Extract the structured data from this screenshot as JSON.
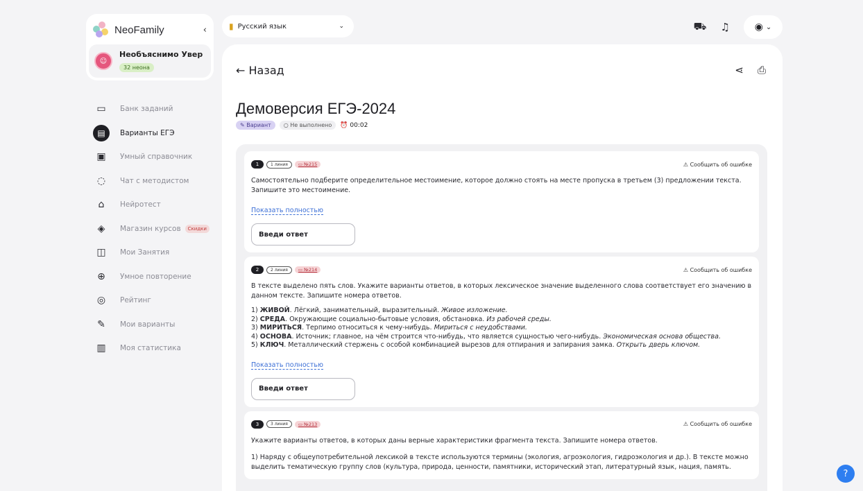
{
  "brand": {
    "name": "NeoFamily",
    "collapse_icon": "chevron-left-icon"
  },
  "user": {
    "name": "Необъяснимо Уверенн…",
    "neon": "32 неона"
  },
  "nav": {
    "items": [
      {
        "label": "Банк заданий",
        "icon": "archive-icon"
      },
      {
        "label": "Варианты ЕГЭ",
        "icon": "document-icon"
      },
      {
        "label": "Умный справочник",
        "icon": "book-icon"
      },
      {
        "label": "Чат с методистом",
        "icon": "chat-icon"
      },
      {
        "label": "Нейротест",
        "icon": "robot-icon"
      },
      {
        "label": "Магазин курсов",
        "icon": "graduation-cap-icon",
        "badge": "Скидки"
      },
      {
        "label": "Мои Занятия",
        "icon": "open-book-icon"
      },
      {
        "label": "Умное повторение",
        "icon": "brain-icon"
      },
      {
        "label": "Рейтинг",
        "icon": "target-icon"
      },
      {
        "label": "Мои варианты",
        "icon": "pencil-icon"
      },
      {
        "label": "Моя статистика",
        "icon": "bar-chart-icon"
      }
    ]
  },
  "subject": {
    "label": "Русский язык"
  },
  "main": {
    "back_label": "Назад",
    "title": "Демоверсия ЕГЭ-2024",
    "variant_tag": "Вариант",
    "status": "Не выполнено",
    "timer": "00:02"
  },
  "tasks": [
    {
      "num": "1",
      "line": "1 линия",
      "bank": "№215",
      "report": "Сообщить об ошибке",
      "text": "Самостоятельно подберите определительное местоимение, которое должно стоять на месте пропуска в третьем (3) предложении текста. Запишите это местоимение.",
      "show_full": "Показать полностью",
      "answer_placeholder": "Введи ответ"
    },
    {
      "num": "2",
      "line": "2 линия",
      "bank": "№214",
      "report": "Сообщить об ошибке",
      "text": "В тексте выделено пять слов. Укажите варианты ответов, в которых лексическое значение выделенного слова соответствует его значению в данном тексте. Запишите номера ответов.",
      "items": [
        {
          "n": "1) ",
          "word": "ЖИВОЙ",
          "desc": ". Лёгкий, занимательный, выразительный. ",
          "ex": "Живое изложение."
        },
        {
          "n": "2) ",
          "word": "СРЕДА",
          "desc": ". Окружающие социально-бытовые условия, обстановка. ",
          "ex": "Из рабочей среды."
        },
        {
          "n": "3) ",
          "word": "МИРИТЬСЯ",
          "desc": ". Терпимо относиться к чему-нибудь. ",
          "ex": "Мириться с неудобствами."
        },
        {
          "n": "4) ",
          "word": "ОСНОВА",
          "desc": ". Источник; главное, на чём строится что-нибудь, что является сущностью чего-нибудь. ",
          "ex": "Экономическая основа общества."
        },
        {
          "n": "5) ",
          "word": "КЛЮЧ",
          "desc": ". Металлический стержень с особой комбинацией вырезов для отпирания и запирания замка. ",
          "ex": "Открыть дверь ключом."
        }
      ],
      "show_full": "Показать полностью",
      "answer_placeholder": "Введи ответ"
    },
    {
      "num": "3",
      "line": "3 линия",
      "bank": "№213",
      "report": "Сообщить об ошибке",
      "text": "Укажите варианты ответов, в которых даны верные характеристики фрагмента текста. Запишите номера ответов.",
      "extra": "1) Наряду с общеупотребительной лексикой в тексте используются термины (экология, агроэкология, гидроэкология и др.). В тексте можно выделить тематическую группу слов (культура, природа, ценности, памятники, исторический этап, литературный язык, нация, память."
    }
  ],
  "colors": {
    "accent": "#2e7ef0",
    "link": "#3c6fd6",
    "bank_bg": "#f6d4d6",
    "variant_bg": "#d8d2f3"
  }
}
